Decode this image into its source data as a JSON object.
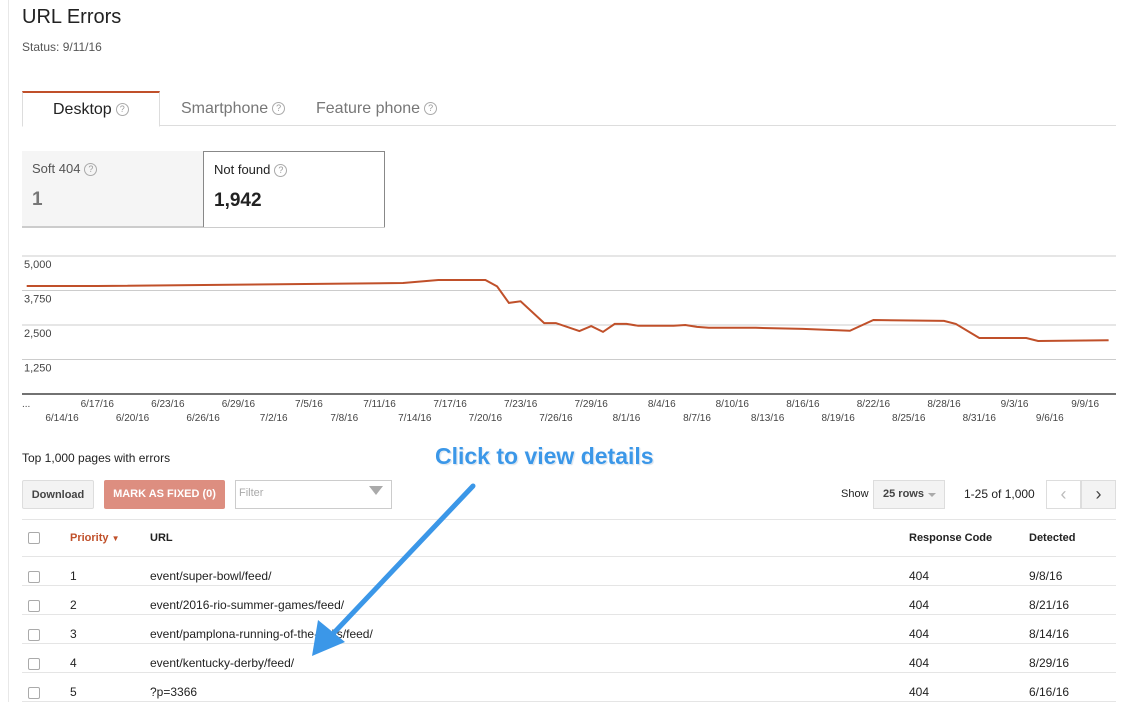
{
  "page": {
    "title": "URL Errors",
    "status": "Status: 9/11/16"
  },
  "tabs": [
    {
      "label": "Desktop",
      "active": true
    },
    {
      "label": "Smartphone"
    },
    {
      "label": "Feature phone"
    }
  ],
  "help_icon": "?",
  "cards": [
    {
      "label": "Soft 404",
      "value": "1"
    },
    {
      "label": "Not found",
      "value": "1,942",
      "selected": true
    }
  ],
  "chart_data": {
    "type": "line",
    "series_color": "#c0502a",
    "ylim": [
      0,
      5000
    ],
    "yticks": [
      "5,000",
      "3,750",
      "2,500",
      "1,250"
    ],
    "ytick_values": [
      5000,
      3750,
      2500,
      1250
    ],
    "grid": true,
    "xtick_first": "...",
    "xticks_top": [
      "6/17/16",
      "6/23/16",
      "6/29/16",
      "7/5/16",
      "7/11/16",
      "7/17/16",
      "7/23/16",
      "7/29/16",
      "8/4/16",
      "8/10/16",
      "8/16/16",
      "8/22/16",
      "8/28/16",
      "9/3/16",
      "9/9/16"
    ],
    "xticks_bottom": [
      "6/14/16",
      "6/20/16",
      "6/26/16",
      "7/2/16",
      "7/8/16",
      "7/14/16",
      "7/20/16",
      "7/26/16",
      "8/1/16",
      "8/7/16",
      "8/13/16",
      "8/19/16",
      "8/25/16",
      "8/31/16",
      "9/6/16"
    ],
    "points": [
      [
        "6/11/16",
        3913
      ],
      [
        "6/17/16",
        3913
      ],
      [
        "7/13/16",
        4020
      ],
      [
        "7/16/16",
        4130
      ],
      [
        "7/20/16",
        4130
      ],
      [
        "7/21/16",
        3900
      ],
      [
        "7/22/16",
        3300
      ],
      [
        "7/23/16",
        3360
      ],
      [
        "7/25/16",
        2570
      ],
      [
        "7/26/16",
        2570
      ],
      [
        "7/28/16",
        2280
      ],
      [
        "7/29/16",
        2460
      ],
      [
        "7/30/16",
        2250
      ],
      [
        "7/31/16",
        2540
      ],
      [
        "8/1/16",
        2540
      ],
      [
        "8/2/16",
        2470
      ],
      [
        "8/5/16",
        2470
      ],
      [
        "8/6/16",
        2500
      ],
      [
        "8/7/16",
        2430
      ],
      [
        "8/8/16",
        2400
      ],
      [
        "8/12/16",
        2400
      ],
      [
        "8/16/16",
        2360
      ],
      [
        "8/20/16",
        2290
      ],
      [
        "8/22/16",
        2680
      ],
      [
        "8/28/16",
        2650
      ],
      [
        "8/29/16",
        2540
      ],
      [
        "8/31/16",
        2030
      ],
      [
        "9/4/16",
        2030
      ],
      [
        "9/5/16",
        1920
      ],
      [
        "9/11/16",
        1950
      ]
    ]
  },
  "table_section": {
    "title": "Top 1,000 pages with errors"
  },
  "toolbar": {
    "download": "Download",
    "mark_fixed": "MARK AS FIXED (0)",
    "filter_placeholder": "Filter",
    "show_label": "Show",
    "rows_select": "25 rows",
    "pager": "1-25 of 1,000",
    "prev": "‹",
    "next": "›"
  },
  "table": {
    "headers": {
      "priority": "Priority",
      "url": "URL",
      "response": "Response Code",
      "detected": "Detected"
    },
    "rows": [
      {
        "priority": "1",
        "url": "event/super-bowl/feed/",
        "response": "404",
        "detected": "9/8/16"
      },
      {
        "priority": "2",
        "url": "event/2016-rio-summer-games/feed/",
        "response": "404",
        "detected": "8/21/16"
      },
      {
        "priority": "3",
        "url": "event/pamplona-running-of-the-bulls/feed/",
        "response": "404",
        "detected": "8/14/16"
      },
      {
        "priority": "4",
        "url": "event/kentucky-derby/feed/",
        "response": "404",
        "detected": "8/29/16"
      },
      {
        "priority": "5",
        "url": "?p=3366",
        "response": "404",
        "detected": "6/16/16"
      }
    ]
  },
  "annotation": {
    "text": "Click to view details",
    "color": "#3b97e8"
  }
}
